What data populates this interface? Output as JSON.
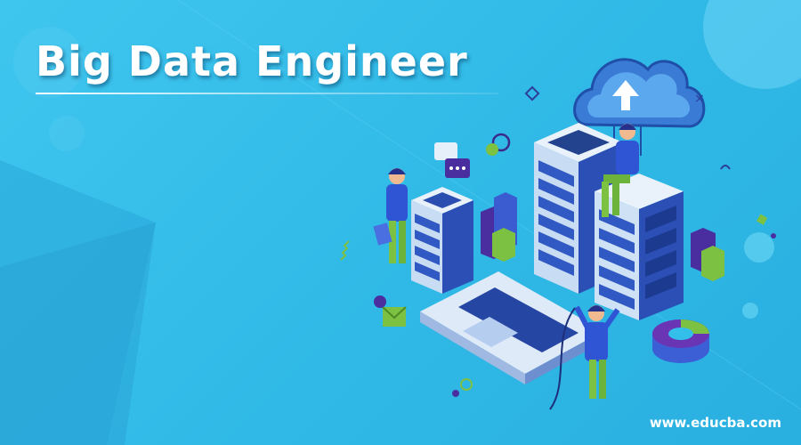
{
  "banner": {
    "title": "Big Data Engineer",
    "site_url": "www.educba.com"
  },
  "colors": {
    "background": "#33bfea",
    "server_body": "#dce9f7",
    "accent_purple": "#4a2ea0",
    "accent_green": "#7cc142",
    "figure_blue": "#2f55d4"
  }
}
